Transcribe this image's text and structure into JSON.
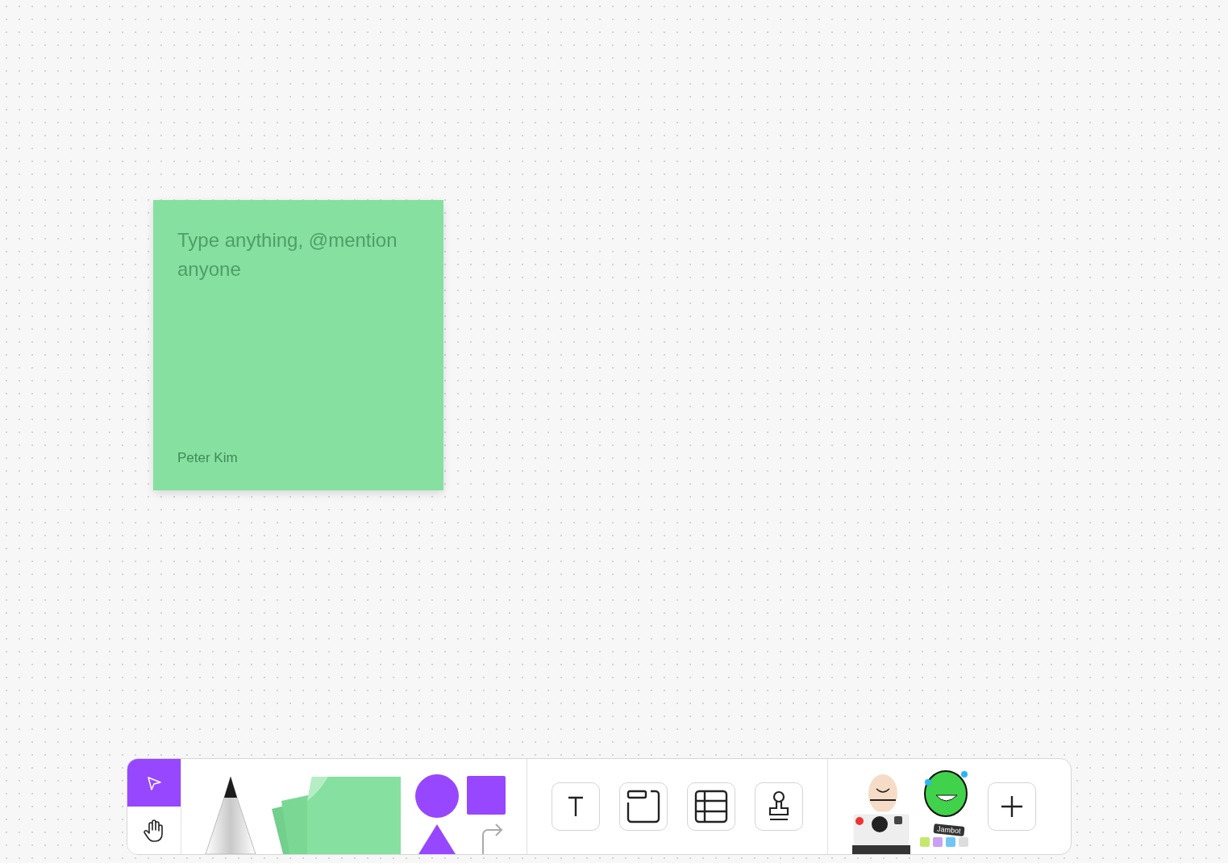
{
  "sticky_note": {
    "color": "#86e0a0",
    "placeholder": "Type anything, @mention anyone",
    "author": "Peter Kim"
  },
  "toolbar": {
    "pointer_tools": [
      {
        "kind": "select",
        "selected": true
      },
      {
        "kind": "hand",
        "selected": false
      }
    ],
    "creation_tools": [
      {
        "kind": "pen"
      },
      {
        "kind": "sticky"
      },
      {
        "kind": "shapes"
      }
    ],
    "insert_tools": [
      {
        "kind": "text"
      },
      {
        "kind": "section"
      },
      {
        "kind": "table"
      },
      {
        "kind": "stamp"
      }
    ],
    "stickers": {
      "label": "Jambot"
    },
    "more_button": {
      "kind": "plus"
    }
  }
}
